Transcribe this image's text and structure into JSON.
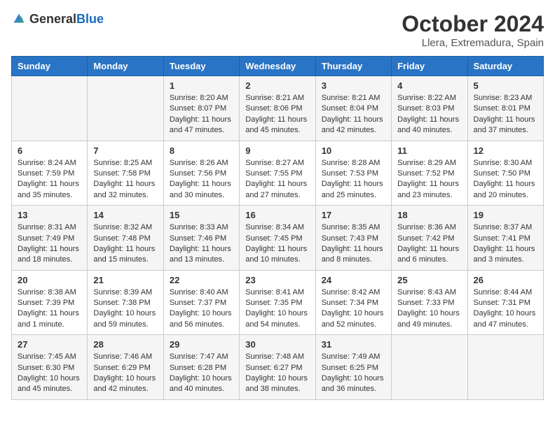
{
  "logo": {
    "general": "General",
    "blue": "Blue"
  },
  "title": "October 2024",
  "subtitle": "Llera, Extremadura, Spain",
  "days_of_week": [
    "Sunday",
    "Monday",
    "Tuesday",
    "Wednesday",
    "Thursday",
    "Friday",
    "Saturday"
  ],
  "weeks": [
    [
      {
        "day": "",
        "info": ""
      },
      {
        "day": "",
        "info": ""
      },
      {
        "day": "1",
        "info": "Sunrise: 8:20 AM\nSunset: 8:07 PM\nDaylight: 11 hours and 47 minutes."
      },
      {
        "day": "2",
        "info": "Sunrise: 8:21 AM\nSunset: 8:06 PM\nDaylight: 11 hours and 45 minutes."
      },
      {
        "day": "3",
        "info": "Sunrise: 8:21 AM\nSunset: 8:04 PM\nDaylight: 11 hours and 42 minutes."
      },
      {
        "day": "4",
        "info": "Sunrise: 8:22 AM\nSunset: 8:03 PM\nDaylight: 11 hours and 40 minutes."
      },
      {
        "day": "5",
        "info": "Sunrise: 8:23 AM\nSunset: 8:01 PM\nDaylight: 11 hours and 37 minutes."
      }
    ],
    [
      {
        "day": "6",
        "info": "Sunrise: 8:24 AM\nSunset: 7:59 PM\nDaylight: 11 hours and 35 minutes."
      },
      {
        "day": "7",
        "info": "Sunrise: 8:25 AM\nSunset: 7:58 PM\nDaylight: 11 hours and 32 minutes."
      },
      {
        "day": "8",
        "info": "Sunrise: 8:26 AM\nSunset: 7:56 PM\nDaylight: 11 hours and 30 minutes."
      },
      {
        "day": "9",
        "info": "Sunrise: 8:27 AM\nSunset: 7:55 PM\nDaylight: 11 hours and 27 minutes."
      },
      {
        "day": "10",
        "info": "Sunrise: 8:28 AM\nSunset: 7:53 PM\nDaylight: 11 hours and 25 minutes."
      },
      {
        "day": "11",
        "info": "Sunrise: 8:29 AM\nSunset: 7:52 PM\nDaylight: 11 hours and 23 minutes."
      },
      {
        "day": "12",
        "info": "Sunrise: 8:30 AM\nSunset: 7:50 PM\nDaylight: 11 hours and 20 minutes."
      }
    ],
    [
      {
        "day": "13",
        "info": "Sunrise: 8:31 AM\nSunset: 7:49 PM\nDaylight: 11 hours and 18 minutes."
      },
      {
        "day": "14",
        "info": "Sunrise: 8:32 AM\nSunset: 7:48 PM\nDaylight: 11 hours and 15 minutes."
      },
      {
        "day": "15",
        "info": "Sunrise: 8:33 AM\nSunset: 7:46 PM\nDaylight: 11 hours and 13 minutes."
      },
      {
        "day": "16",
        "info": "Sunrise: 8:34 AM\nSunset: 7:45 PM\nDaylight: 11 hours and 10 minutes."
      },
      {
        "day": "17",
        "info": "Sunrise: 8:35 AM\nSunset: 7:43 PM\nDaylight: 11 hours and 8 minutes."
      },
      {
        "day": "18",
        "info": "Sunrise: 8:36 AM\nSunset: 7:42 PM\nDaylight: 11 hours and 6 minutes."
      },
      {
        "day": "19",
        "info": "Sunrise: 8:37 AM\nSunset: 7:41 PM\nDaylight: 11 hours and 3 minutes."
      }
    ],
    [
      {
        "day": "20",
        "info": "Sunrise: 8:38 AM\nSunset: 7:39 PM\nDaylight: 11 hours and 1 minute."
      },
      {
        "day": "21",
        "info": "Sunrise: 8:39 AM\nSunset: 7:38 PM\nDaylight: 10 hours and 59 minutes."
      },
      {
        "day": "22",
        "info": "Sunrise: 8:40 AM\nSunset: 7:37 PM\nDaylight: 10 hours and 56 minutes."
      },
      {
        "day": "23",
        "info": "Sunrise: 8:41 AM\nSunset: 7:35 PM\nDaylight: 10 hours and 54 minutes."
      },
      {
        "day": "24",
        "info": "Sunrise: 8:42 AM\nSunset: 7:34 PM\nDaylight: 10 hours and 52 minutes."
      },
      {
        "day": "25",
        "info": "Sunrise: 8:43 AM\nSunset: 7:33 PM\nDaylight: 10 hours and 49 minutes."
      },
      {
        "day": "26",
        "info": "Sunrise: 8:44 AM\nSunset: 7:31 PM\nDaylight: 10 hours and 47 minutes."
      }
    ],
    [
      {
        "day": "27",
        "info": "Sunrise: 7:45 AM\nSunset: 6:30 PM\nDaylight: 10 hours and 45 minutes."
      },
      {
        "day": "28",
        "info": "Sunrise: 7:46 AM\nSunset: 6:29 PM\nDaylight: 10 hours and 42 minutes."
      },
      {
        "day": "29",
        "info": "Sunrise: 7:47 AM\nSunset: 6:28 PM\nDaylight: 10 hours and 40 minutes."
      },
      {
        "day": "30",
        "info": "Sunrise: 7:48 AM\nSunset: 6:27 PM\nDaylight: 10 hours and 38 minutes."
      },
      {
        "day": "31",
        "info": "Sunrise: 7:49 AM\nSunset: 6:25 PM\nDaylight: 10 hours and 36 minutes."
      },
      {
        "day": "",
        "info": ""
      },
      {
        "day": "",
        "info": ""
      }
    ]
  ]
}
